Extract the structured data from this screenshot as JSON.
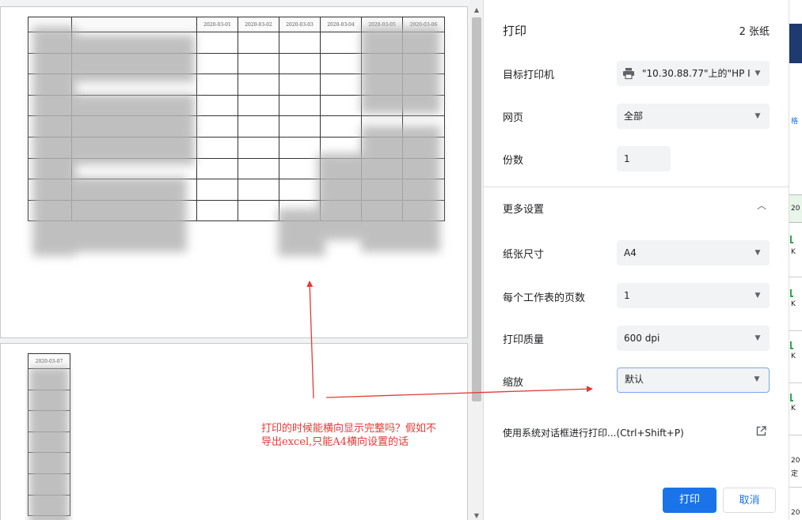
{
  "preview": {
    "page1_dates": [
      "2020-03-01",
      "2020-03-02",
      "2020-03-03",
      "2020-03-04",
      "2020-03-05",
      "2020-03-06"
    ],
    "page2_dates": [
      "2020-03-07"
    ]
  },
  "print_panel": {
    "title": "打印",
    "sheet_count": "2 张纸",
    "rows": {
      "destination": {
        "label": "目标打印机",
        "value": "\"10.30.88.77\"上的\"HP I"
      },
      "pages": {
        "label": "网页",
        "value": "全部"
      },
      "copies": {
        "label": "份数",
        "value": "1"
      },
      "more_settings": {
        "label": "更多设置"
      },
      "paper_size": {
        "label": "纸张尺寸",
        "value": "A4"
      },
      "pages_per_sheet": {
        "label": "每个工作表的页数",
        "value": "1"
      },
      "quality": {
        "label": "打印质量",
        "value": "600 dpi"
      },
      "scale": {
        "label": "缩放",
        "value": "默认"
      }
    },
    "system_dialog": "使用系统对话框进行打印...(Ctrl+Shift+P)",
    "print_button": "打印",
    "cancel_button": "取消"
  },
  "background_app": {
    "fragments": [
      "20",
      "K",
      "K",
      "K",
      "K",
      "20",
      "定",
      "20"
    ]
  },
  "annotation": {
    "line1": "打印的时候能横向显示完整吗？假如不",
    "line2": "导出excel,只能A4横向设置的话",
    "color": "#e53935"
  },
  "colors": {
    "accent": "#1a73e8",
    "annotation": "#e53935"
  }
}
